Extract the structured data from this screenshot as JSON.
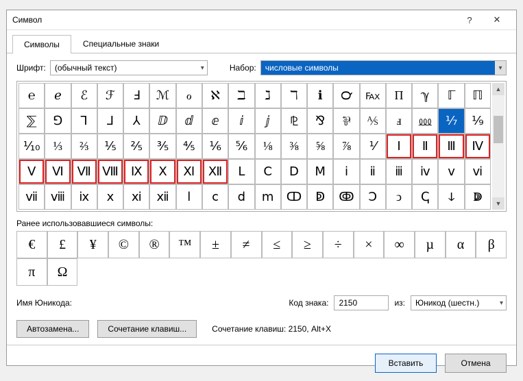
{
  "title": "Символ",
  "help_icon": "?",
  "close_icon": "✕",
  "tabs": {
    "symbols": "Символы",
    "special": "Специальные знаки"
  },
  "font_label": "Шрифт:",
  "font_value": "(обычный текст)",
  "set_label": "Набор:",
  "set_value": "числовые символы",
  "grid": [
    [
      "℮",
      "ℯ",
      "ℰ",
      "ℱ",
      "Ⅎ",
      "ℳ",
      "ℴ",
      "ℵ",
      "ℶ",
      "ℷ",
      "ℸ",
      "ℹ",
      "℺",
      "℻",
      "Π",
      "ℽ",
      "ℾ",
      "ℿ"
    ],
    [
      "⅀",
      "⅁",
      "⅂",
      "⅃",
      "⅄",
      "ⅅ",
      "ⅆ",
      "ⅇ",
      "ⅈ",
      "ⅉ",
      "⅊",
      "⅋",
      "⅌",
      "⅍",
      "ⅎ",
      "⅏",
      "⅐",
      "⅑"
    ],
    [
      "⅒",
      "⅓",
      "⅔",
      "⅕",
      "⅖",
      "⅗",
      "⅘",
      "⅙",
      "⅚",
      "⅛",
      "⅜",
      "⅝",
      "⅞",
      "⅟",
      "Ⅰ",
      "Ⅱ",
      "Ⅲ",
      "Ⅳ"
    ],
    [
      "Ⅴ",
      "Ⅵ",
      "Ⅶ",
      "Ⅷ",
      "Ⅸ",
      "Ⅹ",
      "Ⅺ",
      "Ⅻ",
      "Ⅼ",
      "Ⅽ",
      "Ⅾ",
      "Ⅿ",
      "ⅰ",
      "ⅱ",
      "ⅲ",
      "ⅳ",
      "ⅴ",
      "ⅵ"
    ],
    [
      "ⅶ",
      "ⅷ",
      "ⅸ",
      "ⅹ",
      "ⅺ",
      "ⅻ",
      "ⅼ",
      "ⅽ",
      "ⅾ",
      "ⅿ",
      "ↀ",
      "ↁ",
      "ↂ",
      "Ↄ",
      "ↄ",
      "ↅ",
      "ↆ",
      "ↇ"
    ]
  ],
  "selected_cell": "⅐",
  "red_group1": [
    "Ⅰ",
    "Ⅱ",
    "Ⅲ",
    "Ⅳ"
  ],
  "red_group2": [
    "Ⅴ",
    "Ⅵ",
    "Ⅶ",
    "Ⅷ",
    "Ⅸ",
    "Ⅹ",
    "Ⅺ",
    "Ⅻ"
  ],
  "recent_label": "Ранее использовавшиеся символы:",
  "recent": [
    "€",
    "£",
    "¥",
    "©",
    "®",
    "™",
    "±",
    "≠",
    "≤",
    "≥",
    "÷",
    "×",
    "∞",
    "µ",
    "α",
    "β",
    "π",
    "Ω"
  ],
  "unicode_name_label": "Имя Юникода:",
  "code_label": "Код знака:",
  "code_value": "2150",
  "from_label": "из:",
  "from_value": "Юникод (шестн.)",
  "autocorrect_btn": "Автозамена...",
  "shortcut_btn": "Сочетание клавиш...",
  "shortcut_text": "Сочетание клавиш: 2150, Alt+X",
  "insert_btn": "Вставить",
  "cancel_btn": "Отмена"
}
